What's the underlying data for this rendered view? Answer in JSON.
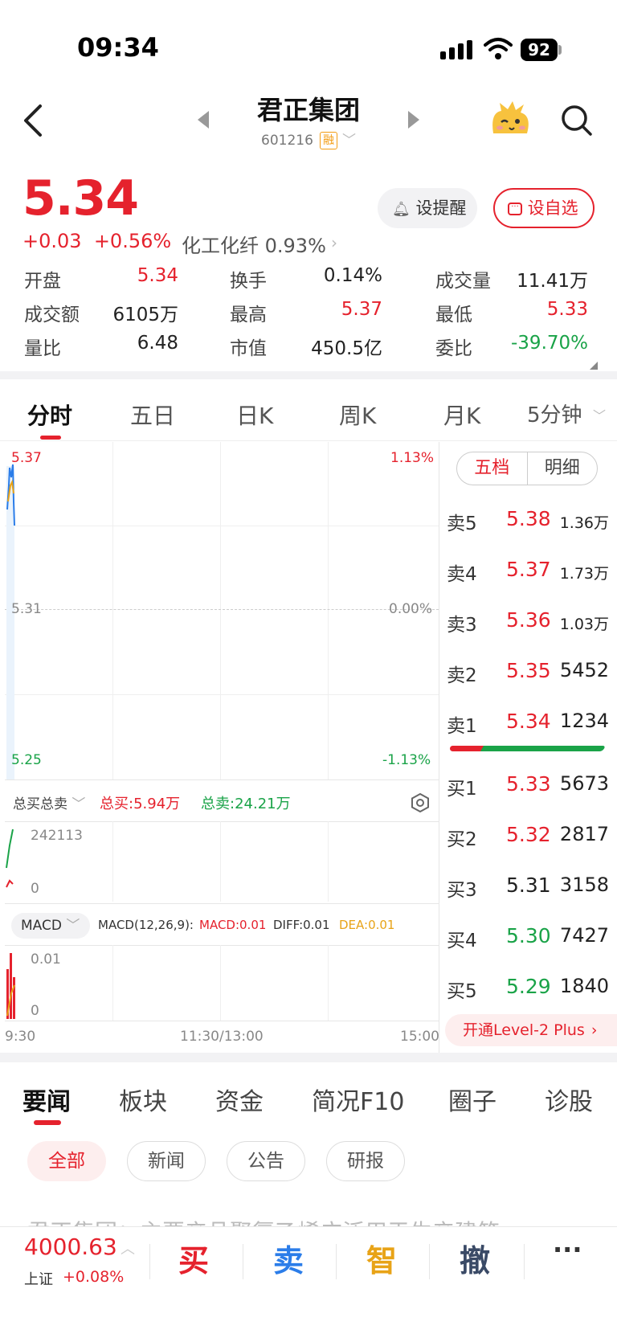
{
  "status_bar": {
    "time": "09:34",
    "battery": "92"
  },
  "header": {
    "title": "君正集团",
    "code": "601216",
    "badge": "融"
  },
  "quote": {
    "price": "5.34",
    "change": "+0.03",
    "change_pct": "+0.56%",
    "sector_name": "化工化纤",
    "sector_pct": "0.93%",
    "alert_label": "设提醒",
    "watchlist_label": "设自选"
  },
  "stats": [
    {
      "label": "开盘",
      "value": "5.34",
      "color": "red"
    },
    {
      "label": "换手",
      "value": "0.14%",
      "color": "black"
    },
    {
      "label": "成交量",
      "value": "11.41万",
      "color": "black"
    },
    {
      "label": "成交额",
      "value": "6105万",
      "color": "black"
    },
    {
      "label": "最高",
      "value": "5.37",
      "color": "red"
    },
    {
      "label": "最低",
      "value": "5.33",
      "color": "red"
    },
    {
      "label": "量比",
      "value": "6.48",
      "color": "black"
    },
    {
      "label": "市值",
      "value": "450.5亿",
      "color": "black"
    },
    {
      "label": "委比",
      "value": "-39.70%",
      "color": "green"
    }
  ],
  "chart_tabs": [
    "分时",
    "五日",
    "日K",
    "周K",
    "月K",
    "5分钟"
  ],
  "chart": {
    "price_high": "5.37",
    "price_mid": "5.31",
    "price_low": "5.25",
    "pct_high": "1.13%",
    "pct_mid": "0.00%",
    "pct_low": "-1.13%",
    "volume_selector": "总买总卖",
    "total_buy": "总买:5.94万",
    "total_sell": "总卖:24.21万",
    "volume_max": "242113",
    "volume_zero": "0",
    "macd_selector": "MACD",
    "macd_params": "MACD(12,26,9):",
    "macd_value": "MACD:0.01",
    "diff_value": "DIFF:0.01",
    "dea_value": "DEA:0.01",
    "macd_max": "0.01",
    "macd_zero": "0",
    "time_start": "9:30",
    "time_mid": "11:30/13:00",
    "time_end": "15:00"
  },
  "order_book": {
    "tab_active": "五档",
    "tab_other": "明细",
    "asks": [
      {
        "label": "卖5",
        "price": "5.38",
        "vol": "1.36万",
        "color": "red"
      },
      {
        "label": "卖4",
        "price": "5.37",
        "vol": "1.73万",
        "color": "red"
      },
      {
        "label": "卖3",
        "price": "5.36",
        "vol": "1.03万",
        "color": "red"
      },
      {
        "label": "卖2",
        "price": "5.35",
        "vol": "5452",
        "color": "red"
      },
      {
        "label": "卖1",
        "price": "5.34",
        "vol": "1234",
        "color": "red"
      }
    ],
    "bids": [
      {
        "label": "买1",
        "price": "5.33",
        "vol": "5673",
        "color": "red"
      },
      {
        "label": "买2",
        "price": "5.32",
        "vol": "2817",
        "color": "red"
      },
      {
        "label": "买3",
        "price": "5.31",
        "vol": "3158",
        "color": "black"
      },
      {
        "label": "买4",
        "price": "5.30",
        "vol": "7427",
        "color": "green"
      },
      {
        "label": "买5",
        "price": "5.29",
        "vol": "1840",
        "color": "green"
      }
    ],
    "level2_label": "开通Level-2 Plus"
  },
  "news_tabs": [
    "要闻",
    "板块",
    "资金",
    "简况F10",
    "圈子",
    "诊股"
  ],
  "news_filters": [
    "全部",
    "新闻",
    "公告",
    "研报"
  ],
  "news_peek": "君正集团：主要产品聚氯乙烯广泛用于生产建筑",
  "bottom_bar": {
    "index_value": "4000.63",
    "index_name": "上证",
    "index_change": "+0.08%",
    "buy": "买",
    "sell": "卖",
    "smart": "智",
    "cancel": "撤",
    "more": "···"
  },
  "colors": {
    "red": "#e5222d",
    "green": "#1aa348",
    "orange": "#e8a317",
    "blue": "#2b7de9"
  }
}
